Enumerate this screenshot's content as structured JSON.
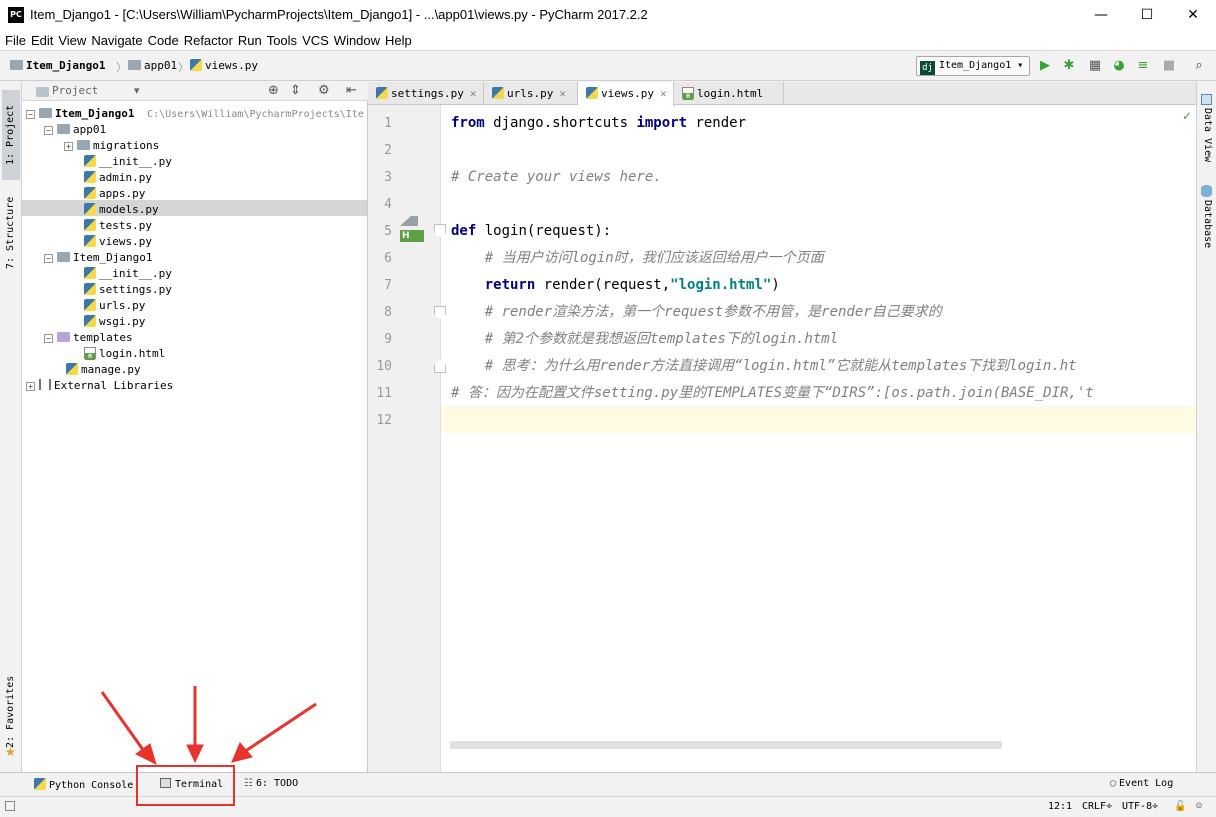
{
  "window": {
    "title": "Item_Django1 - [C:\\Users\\William\\PycharmProjects\\Item_Django1] - ...\\app01\\views.py - PyCharm 2017.2.2",
    "app_icon_text": "PC",
    "minimize": "—",
    "maximize": "☐",
    "close": "✕"
  },
  "menu": [
    "File",
    "Edit",
    "View",
    "Navigate",
    "Code",
    "Refactor",
    "Run",
    "Tools",
    "VCS",
    "Window",
    "Help"
  ],
  "breadcrumb": [
    "Item_Django1",
    "app01",
    "views.py"
  ],
  "run_config": {
    "icon_text": "dj",
    "label": "Item_Django1 ▾"
  },
  "left_tabs": {
    "project": "1: Project",
    "structure": "7: Structure",
    "favorites": "2: Favorites"
  },
  "right_tabs": {
    "data_view": "Data View",
    "database": "Database"
  },
  "project_panel": {
    "header": "Project",
    "dropdown": "▾",
    "root_name": "Item_Django1",
    "root_path": "C:\\Users\\William\\PycharmProjects\\Ite",
    "items": [
      "app01",
      "migrations",
      "__init__.py",
      "admin.py",
      "apps.py",
      "models.py",
      "tests.py",
      "views.py",
      "Item_Django1",
      "__init__.py",
      "settings.py",
      "urls.py",
      "wsgi.py",
      "templates",
      "login.html",
      "manage.py",
      "External Libraries"
    ]
  },
  "tabs": [
    "settings.py",
    "urls.py",
    "views.py",
    "login.html"
  ],
  "editor": {
    "line_numbers": [
      "1",
      "2",
      "3",
      "4",
      "5",
      "6",
      "7",
      "8",
      "9",
      "10",
      "11",
      "12"
    ],
    "line1": {
      "kw1": "from",
      "mid": " django.shortcuts ",
      "kw2": "import",
      "rest": " render"
    },
    "line3": "# Create your views here.",
    "line5": {
      "kw": "def",
      "rest": " login(request):"
    },
    "line6": "    # 当用户访问login时，我们应该返回给用户一个页面",
    "line7": {
      "indent": "    ",
      "kw": "return",
      "mid": " render(request,",
      "str": "\"login.html\"",
      "end": ")"
    },
    "line8": "    # render渲染方法，第一个request参数不用管，是render自己要求的",
    "line9": "    # 第2个参数就是我想返回templates下的login.html",
    "line10": "    # 思考：为什么用render方法直接调用“login.html”它就能从templates下找到login.ht",
    "line11": "# 答：因为在配置文件setting.py里的TEMPLATES变量下“DIRS”:[os.path.join(BASE_DIR,'t"
  },
  "bottom_tabs": {
    "python_console": "Python Console",
    "terminal": "Terminal",
    "todo": "6: TODO",
    "event_log": "Event Log"
  },
  "status": {
    "position": "12:1",
    "line_sep": "CRLF÷",
    "encoding": "UTF-8÷"
  },
  "colors": {
    "annotation": "#e8322c",
    "keyword": "#000080",
    "comment": "#808080",
    "string": "#008080"
  }
}
